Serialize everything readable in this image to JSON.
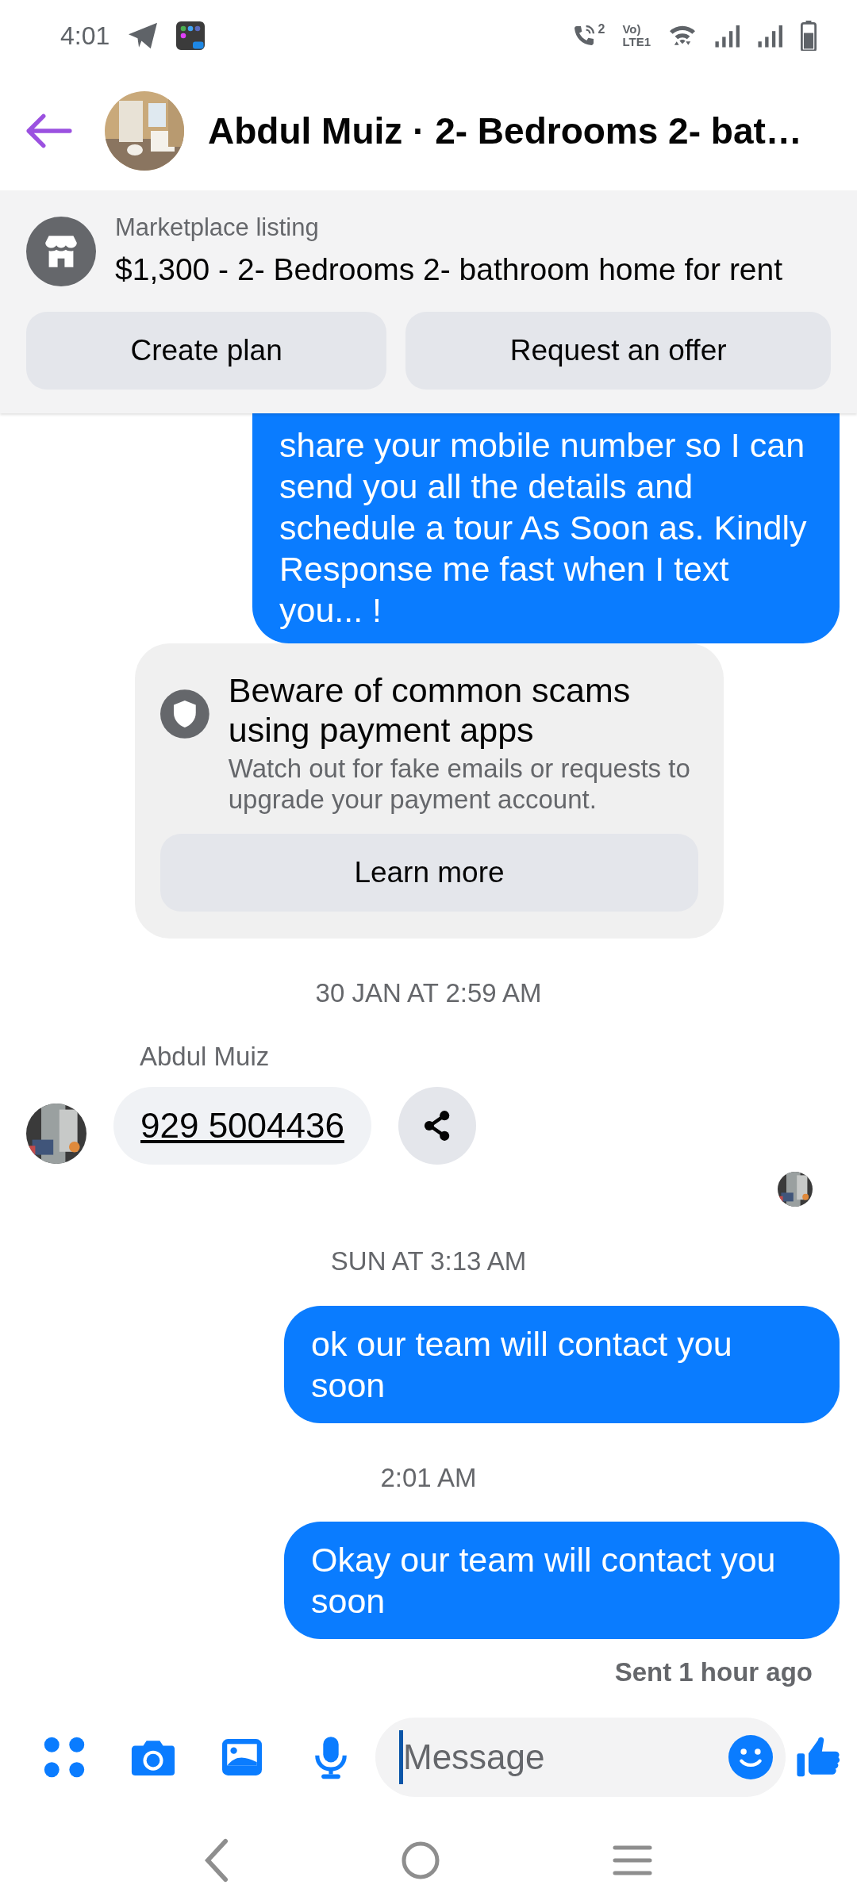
{
  "status_bar": {
    "time": "4:01",
    "call_sim": "2",
    "volte": "Vo)",
    "lte": "LTE1"
  },
  "header": {
    "title": "Abdul Muiz · 2- Bedrooms 2- bat…"
  },
  "listing": {
    "label": "Marketplace listing",
    "title": "$1,300 - 2- Bedrooms 2- bathroom home for rent",
    "buttons": [
      "Create plan",
      "Request an offer"
    ]
  },
  "messages": [
    {
      "kind": "outgoing",
      "text": "share your mobile number so I can send you all the details and schedule a tour As Soon as. Kindly Response me fast when I text you... !",
      "cut_top": true
    },
    {
      "kind": "notice",
      "title": "Beware of common scams using payment apps",
      "text": "Watch out for fake emails or requests to upgrade your payment account.",
      "button": "Learn more"
    },
    {
      "kind": "timestamp",
      "text": "30 JAN AT 2:59 AM"
    },
    {
      "kind": "incoming",
      "sender": "Abdul Muiz",
      "text": "929 5004436",
      "link": true
    },
    {
      "kind": "read_receipt"
    },
    {
      "kind": "timestamp",
      "text": "SUN AT 3:13 AM"
    },
    {
      "kind": "outgoing",
      "text": "ok our team will contact you soon",
      "cut_top": false
    },
    {
      "kind": "timestamp",
      "text": "2:01 AM"
    },
    {
      "kind": "outgoing",
      "text": "Okay our team will contact you soon",
      "cut_top": false
    },
    {
      "kind": "status",
      "text": "Sent 1 hour ago"
    }
  ],
  "composer": {
    "placeholder": "Message"
  }
}
